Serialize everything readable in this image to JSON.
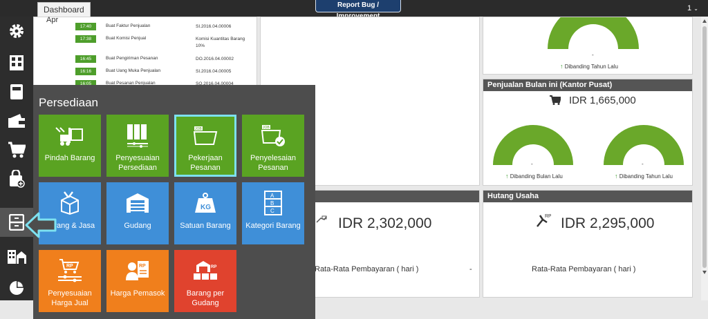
{
  "header": {
    "tab_label": "Dashboard",
    "report_button": "Report Bug / Improvement",
    "user_menu": "1"
  },
  "sidebar": {
    "items": [
      {
        "icon": "gear-icon"
      },
      {
        "icon": "building-icon"
      },
      {
        "icon": "book-icon"
      },
      {
        "icon": "wallet-icon"
      },
      {
        "icon": "cart-icon"
      },
      {
        "icon": "bag-add-icon"
      },
      {
        "icon": "cabinet-icon"
      },
      {
        "icon": "warehouse-icon"
      },
      {
        "icon": "pie-chart-icon"
      }
    ]
  },
  "activity": {
    "rows": [
      {
        "time": "17:40",
        "desc": "Buat Faktur Penjualan",
        "ref": "SI.2016.04.00006"
      },
      {
        "time": "17:38",
        "desc": "Buat Komisi Penjual",
        "ref": "Komisi Kuantitas Barang 10%"
      },
      {
        "time": "16:45",
        "desc": "Buat Pengiriman Pesanan",
        "ref": "DO.2016.04.00002"
      },
      {
        "time": "16:16",
        "desc": "Buat Uang Muka Penjualan",
        "ref": "SI.2016.04.00005"
      },
      {
        "time": "16:05",
        "desc": "Buat Pesanan Penjualan",
        "ref": "SO.2016.04.00004"
      }
    ]
  },
  "top_gauge": {
    "value": "-",
    "compare": "Dibanding Tahun Lalu"
  },
  "penjualan": {
    "title": "Penjualan Bulan ini (Kantor Pusat)",
    "amount": "IDR 1,665,000",
    "gauge_left_value": "-",
    "gauge_left_label": "Dibanding Bulan Lalu",
    "gauge_right_value": "-",
    "gauge_right_label": "Dibanding Tahun Lalu"
  },
  "piutang": {
    "title": "",
    "amount": "IDR 2,302,000",
    "rata_label": "Rata-Rata Pembayaran ( hari )",
    "rata_value": "-"
  },
  "hutang": {
    "title": "Hutang Usaha",
    "amount": "IDR 2,295,000",
    "rata_label": "Rata-Rata Pembayaran ( hari )"
  },
  "persediaan": {
    "title": "Persediaan",
    "tiles": [
      {
        "label": "Pindah Barang",
        "icon": "forklift-icon",
        "color": "#5aa322"
      },
      {
        "label": "Penyesuaian Persediaan",
        "icon": "binders-icon",
        "color": "#5aa322"
      },
      {
        "label": "Pekerjaan Pesanan",
        "icon": "job-folder-icon",
        "color": "#5aa322"
      },
      {
        "label": "Penyelesaian Pesanan",
        "icon": "job-check-icon",
        "color": "#5aa322"
      },
      {
        "label": "Barang & Jasa",
        "icon": "box-tools-icon",
        "color": "#3f8fd8"
      },
      {
        "label": "Gudang",
        "icon": "garage-icon",
        "color": "#3f8fd8"
      },
      {
        "label": "Satuan Barang",
        "icon": "weight-kg-icon",
        "color": "#3f8fd8"
      },
      {
        "label": "Kategori Barang",
        "icon": "abc-list-icon",
        "color": "#3f8fd8"
      },
      {
        "label": "Penyesuaian Harga Jual",
        "icon": "price-cart-icon",
        "color": "#f07f1c"
      },
      {
        "label": "Harga Pemasok",
        "icon": "supplier-price-icon",
        "color": "#f07f1c"
      },
      {
        "label": "Barang per Gudang",
        "icon": "stock-warehouse-icon",
        "color": "#e0432e"
      }
    ],
    "kg_text": "KG",
    "rp_text": "RP",
    "job_text": "JOB"
  }
}
